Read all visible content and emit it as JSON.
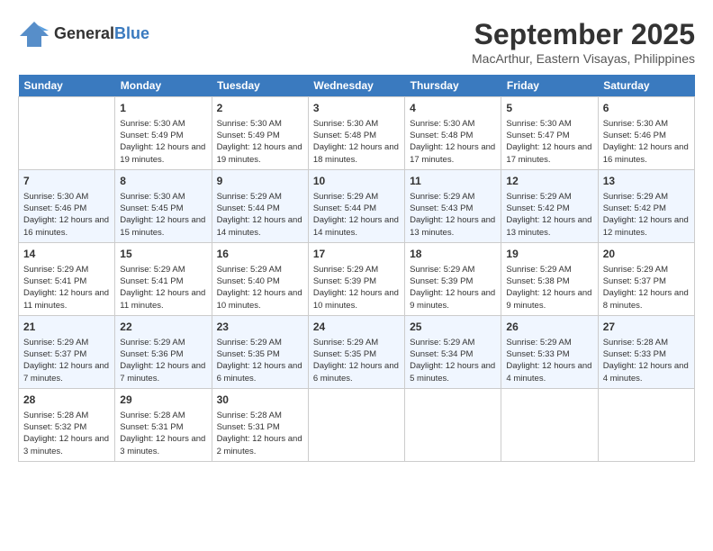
{
  "header": {
    "logo_line1": "General",
    "logo_line2": "Blue",
    "title": "September 2025",
    "location": "MacArthur, Eastern Visayas, Philippines"
  },
  "days_of_week": [
    "Sunday",
    "Monday",
    "Tuesday",
    "Wednesday",
    "Thursday",
    "Friday",
    "Saturday"
  ],
  "weeks": [
    [
      {
        "day": null
      },
      {
        "day": "1",
        "sunrise": "5:30 AM",
        "sunset": "5:49 PM",
        "daylight": "12 hours and 19 minutes."
      },
      {
        "day": "2",
        "sunrise": "5:30 AM",
        "sunset": "5:49 PM",
        "daylight": "12 hours and 19 minutes."
      },
      {
        "day": "3",
        "sunrise": "5:30 AM",
        "sunset": "5:48 PM",
        "daylight": "12 hours and 18 minutes."
      },
      {
        "day": "4",
        "sunrise": "5:30 AM",
        "sunset": "5:48 PM",
        "daylight": "12 hours and 17 minutes."
      },
      {
        "day": "5",
        "sunrise": "5:30 AM",
        "sunset": "5:47 PM",
        "daylight": "12 hours and 17 minutes."
      },
      {
        "day": "6",
        "sunrise": "5:30 AM",
        "sunset": "5:46 PM",
        "daylight": "12 hours and 16 minutes."
      }
    ],
    [
      {
        "day": "7",
        "sunrise": "5:30 AM",
        "sunset": "5:46 PM",
        "daylight": "12 hours and 16 minutes."
      },
      {
        "day": "8",
        "sunrise": "5:30 AM",
        "sunset": "5:45 PM",
        "daylight": "12 hours and 15 minutes."
      },
      {
        "day": "9",
        "sunrise": "5:29 AM",
        "sunset": "5:44 PM",
        "daylight": "12 hours and 14 minutes."
      },
      {
        "day": "10",
        "sunrise": "5:29 AM",
        "sunset": "5:44 PM",
        "daylight": "12 hours and 14 minutes."
      },
      {
        "day": "11",
        "sunrise": "5:29 AM",
        "sunset": "5:43 PM",
        "daylight": "12 hours and 13 minutes."
      },
      {
        "day": "12",
        "sunrise": "5:29 AM",
        "sunset": "5:42 PM",
        "daylight": "12 hours and 13 minutes."
      },
      {
        "day": "13",
        "sunrise": "5:29 AM",
        "sunset": "5:42 PM",
        "daylight": "12 hours and 12 minutes."
      }
    ],
    [
      {
        "day": "14",
        "sunrise": "5:29 AM",
        "sunset": "5:41 PM",
        "daylight": "12 hours and 11 minutes."
      },
      {
        "day": "15",
        "sunrise": "5:29 AM",
        "sunset": "5:41 PM",
        "daylight": "12 hours and 11 minutes."
      },
      {
        "day": "16",
        "sunrise": "5:29 AM",
        "sunset": "5:40 PM",
        "daylight": "12 hours and 10 minutes."
      },
      {
        "day": "17",
        "sunrise": "5:29 AM",
        "sunset": "5:39 PM",
        "daylight": "12 hours and 10 minutes."
      },
      {
        "day": "18",
        "sunrise": "5:29 AM",
        "sunset": "5:39 PM",
        "daylight": "12 hours and 9 minutes."
      },
      {
        "day": "19",
        "sunrise": "5:29 AM",
        "sunset": "5:38 PM",
        "daylight": "12 hours and 9 minutes."
      },
      {
        "day": "20",
        "sunrise": "5:29 AM",
        "sunset": "5:37 PM",
        "daylight": "12 hours and 8 minutes."
      }
    ],
    [
      {
        "day": "21",
        "sunrise": "5:29 AM",
        "sunset": "5:37 PM",
        "daylight": "12 hours and 7 minutes."
      },
      {
        "day": "22",
        "sunrise": "5:29 AM",
        "sunset": "5:36 PM",
        "daylight": "12 hours and 7 minutes."
      },
      {
        "day": "23",
        "sunrise": "5:29 AM",
        "sunset": "5:35 PM",
        "daylight": "12 hours and 6 minutes."
      },
      {
        "day": "24",
        "sunrise": "5:29 AM",
        "sunset": "5:35 PM",
        "daylight": "12 hours and 6 minutes."
      },
      {
        "day": "25",
        "sunrise": "5:29 AM",
        "sunset": "5:34 PM",
        "daylight": "12 hours and 5 minutes."
      },
      {
        "day": "26",
        "sunrise": "5:29 AM",
        "sunset": "5:33 PM",
        "daylight": "12 hours and 4 minutes."
      },
      {
        "day": "27",
        "sunrise": "5:28 AM",
        "sunset": "5:33 PM",
        "daylight": "12 hours and 4 minutes."
      }
    ],
    [
      {
        "day": "28",
        "sunrise": "5:28 AM",
        "sunset": "5:32 PM",
        "daylight": "12 hours and 3 minutes."
      },
      {
        "day": "29",
        "sunrise": "5:28 AM",
        "sunset": "5:31 PM",
        "daylight": "12 hours and 3 minutes."
      },
      {
        "day": "30",
        "sunrise": "5:28 AM",
        "sunset": "5:31 PM",
        "daylight": "12 hours and 2 minutes."
      },
      {
        "day": null
      },
      {
        "day": null
      },
      {
        "day": null
      },
      {
        "day": null
      }
    ]
  ],
  "labels": {
    "sunrise": "Sunrise:",
    "sunset": "Sunset:",
    "daylight": "Daylight:"
  }
}
